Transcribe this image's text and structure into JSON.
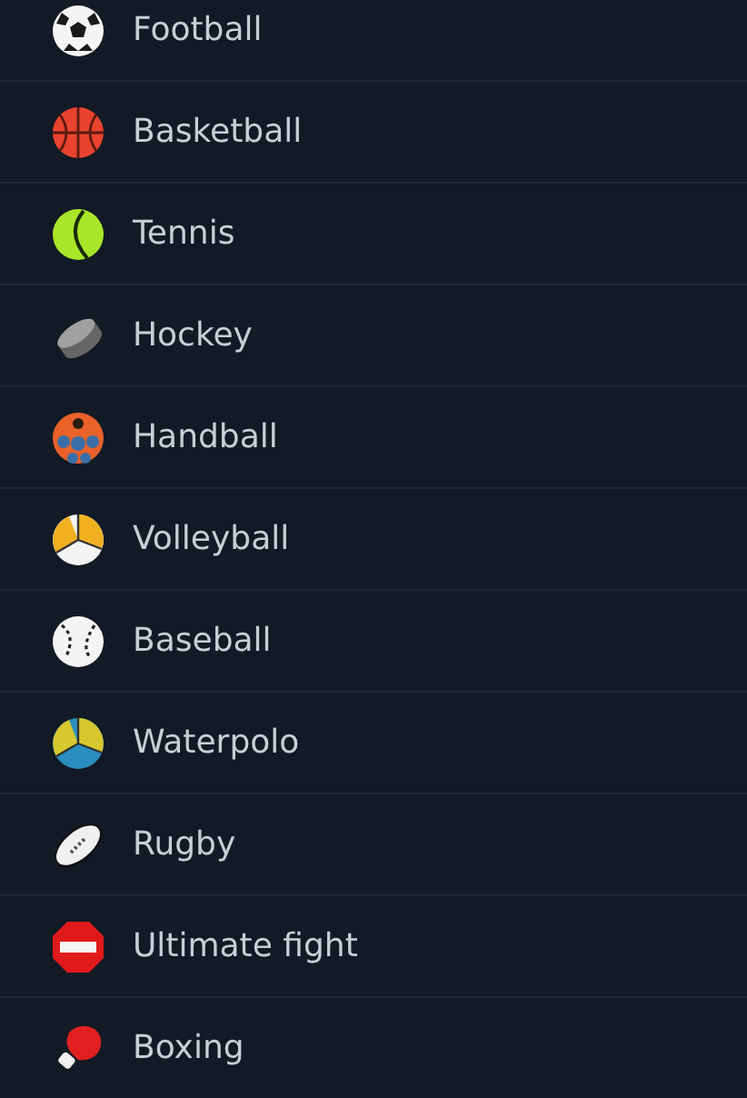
{
  "sports": [
    {
      "label": "Football",
      "kind": "football"
    },
    {
      "label": "Basketball",
      "kind": "basketball"
    },
    {
      "label": "Tennis",
      "kind": "tennis"
    },
    {
      "label": "Hockey",
      "kind": "hockey"
    },
    {
      "label": "Handball",
      "kind": "handball"
    },
    {
      "label": "Volleyball",
      "kind": "volleyball"
    },
    {
      "label": "Baseball",
      "kind": "baseball"
    },
    {
      "label": "Waterpolo",
      "kind": "waterpolo"
    },
    {
      "label": "Rugby",
      "kind": "rugby"
    },
    {
      "label": "Ultimate fight",
      "kind": "fight"
    },
    {
      "label": "Boxing",
      "kind": "boxing"
    }
  ]
}
